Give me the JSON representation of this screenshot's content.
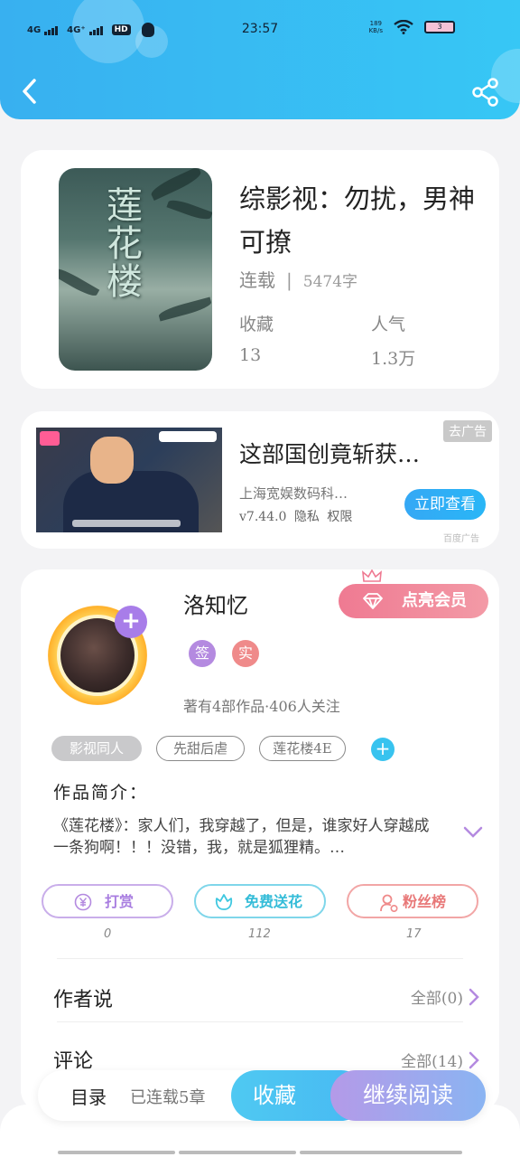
{
  "status_bar": {
    "sig1": "4G",
    "sig2": "4G⁺",
    "hd": "HD",
    "time": "23:57",
    "speed_top": "189",
    "speed_bottom": "KB/s",
    "battery": "3"
  },
  "book": {
    "cover_title": "莲花楼",
    "title": "综影视：勿扰，男神可撩",
    "status": "连载",
    "separator": "|",
    "word_count": "5474字",
    "collect_label": "收藏",
    "collect_value": "13",
    "popularity_label": "人气",
    "popularity_value": "1.3万"
  },
  "ad": {
    "tag": "去广告",
    "title": "这部国创竟斩获…",
    "advertiser": "上海宽娱数码科…",
    "version": "v7.44.0",
    "privacy": "隐私",
    "permissions": "权限",
    "button": "立即查看",
    "source": "百度广告"
  },
  "author": {
    "name": "洛知忆",
    "vip_button": "点亮会员",
    "badge_sign": "签",
    "badge_real": "实",
    "stats": "著有4部作品·406人关注",
    "tags": [
      "影视同人",
      "先甜后虐",
      "莲花楼4E"
    ],
    "intro_heading": "作品简介：",
    "intro_text": "《莲花楼》：家人们，我穿越了，但是，谁家好人穿越成一条狗啊！！！没错，我，就是狐狸精。…",
    "actions": [
      {
        "label": "打赏",
        "count": "0"
      },
      {
        "label": "免费送花",
        "count": "112"
      },
      {
        "label": "粉丝榜",
        "count": "17"
      }
    ],
    "author_says": "作者说",
    "author_says_all": "全部(0)",
    "comments": "评论",
    "comments_all": "全部(14)"
  },
  "bottom": {
    "toc": "目录",
    "serial": "已连载5章",
    "collect": "收藏",
    "read": "继续阅读"
  },
  "colors": {
    "header": "#38b0f0",
    "vip": "#ef7a92",
    "reward": "#b48ae0",
    "flower": "#40c8e0",
    "fans": "#ef8a8a",
    "read_button": "#a7a3ec"
  }
}
